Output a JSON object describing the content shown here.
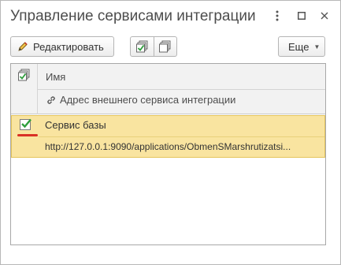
{
  "window": {
    "title": "Управление сервисами интеграции"
  },
  "toolbar": {
    "edit_label": "Редактировать",
    "more_label": "Еще"
  },
  "table": {
    "columns": {
      "name": "Имя",
      "address": "Адрес внешнего сервиса интеграции"
    },
    "rows": [
      {
        "checked": true,
        "name": "Сервис базы",
        "url": "http://127.0.0.1:9090/applications/ObmenSMarshrutizatsi..."
      }
    ]
  },
  "colors": {
    "selected_row": "#f9e4a0",
    "selected_border": "#e4c45c",
    "check_green": "#2e9e3c",
    "annotation_red": "#d93025"
  }
}
